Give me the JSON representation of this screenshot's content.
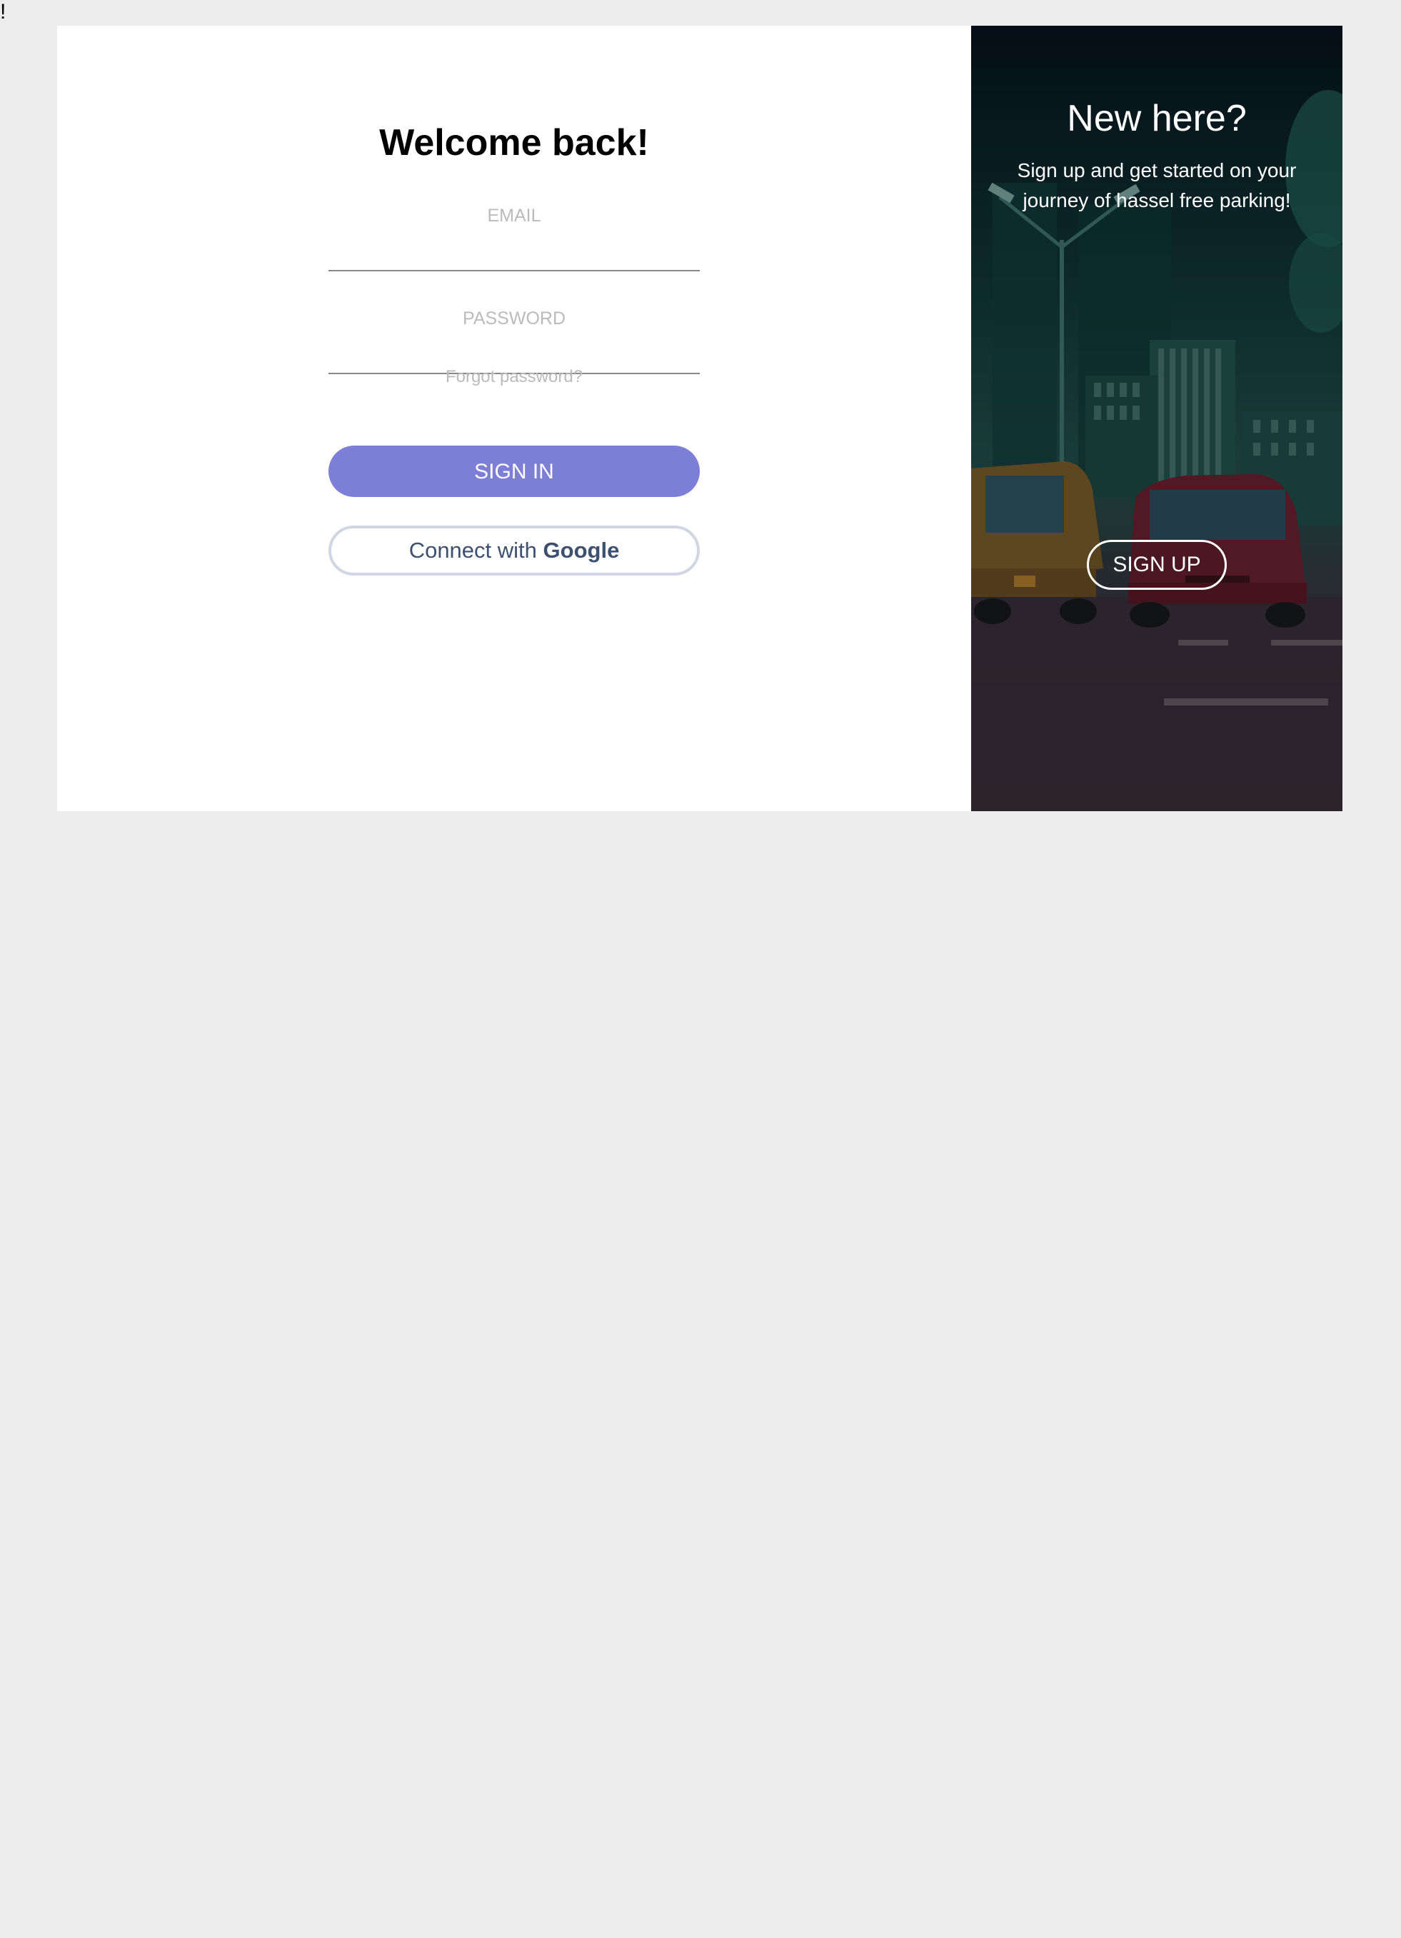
{
  "page": {
    "stray_text": "!"
  },
  "login": {
    "title": "Welcome back!",
    "email_label": "EMAIL",
    "email_value": "",
    "password_label": "PASSWORD",
    "password_value": "",
    "forgot_password": "Forgot password?",
    "signin_label": "SIGN IN",
    "google_prefix": "Connect with",
    "google_brand": "Google"
  },
  "signup_promo": {
    "title": "New here?",
    "text": "Sign up and get started on your journey of hassel free parking!",
    "signup_label": "SIGN UP"
  },
  "colors": {
    "page_background": "#ededed",
    "card_background": "#ffffff",
    "signin_button": "#7d7ed5",
    "google_button_border": "#d0d6e4",
    "google_text": "#3e5070",
    "muted_text": "#bbbbbb"
  },
  "icons": {
    "promo_background": "parking-lot-night-illustration"
  }
}
